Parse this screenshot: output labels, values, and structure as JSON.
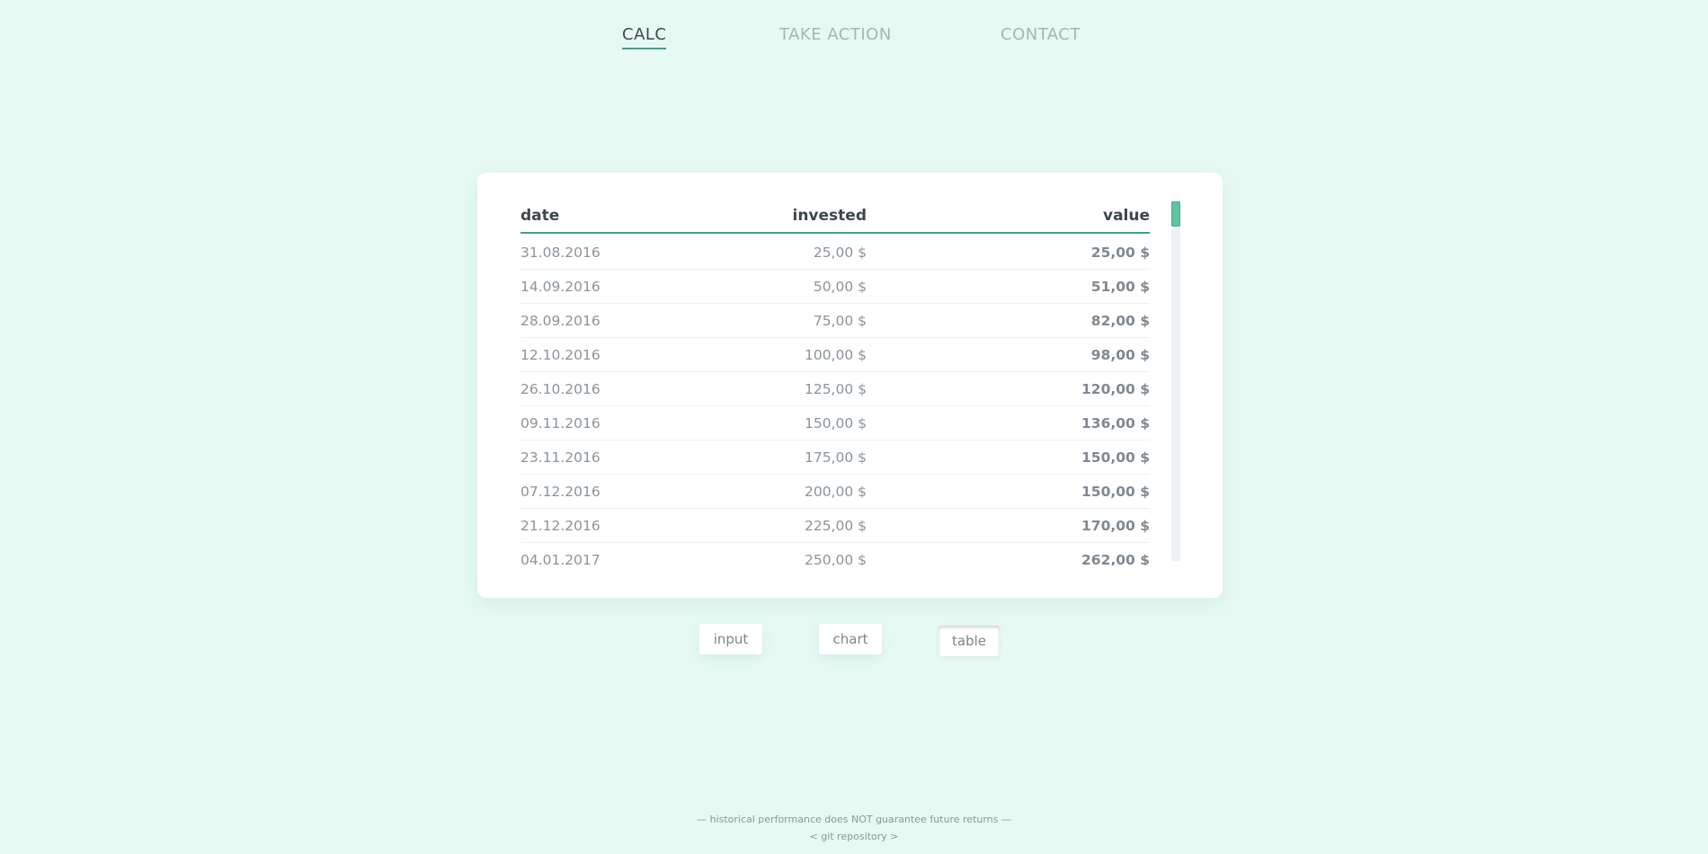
{
  "nav": {
    "calc": "CALC",
    "take_action": "TAKE ACTION",
    "contact": "CONTACT"
  },
  "table": {
    "headers": {
      "date": "date",
      "invested": "invested",
      "value": "value"
    },
    "rows": [
      {
        "date": "31.08.2016",
        "invested": "25,00 $",
        "value": "25,00 $"
      },
      {
        "date": "14.09.2016",
        "invested": "50,00 $",
        "value": "51,00 $"
      },
      {
        "date": "28.09.2016",
        "invested": "75,00 $",
        "value": "82,00 $"
      },
      {
        "date": "12.10.2016",
        "invested": "100,00 $",
        "value": "98,00 $"
      },
      {
        "date": "26.10.2016",
        "invested": "125,00 $",
        "value": "120,00 $"
      },
      {
        "date": "09.11.2016",
        "invested": "150,00 $",
        "value": "136,00 $"
      },
      {
        "date": "23.11.2016",
        "invested": "175,00 $",
        "value": "150,00 $"
      },
      {
        "date": "07.12.2016",
        "invested": "200,00 $",
        "value": "150,00 $"
      },
      {
        "date": "21.12.2016",
        "invested": "225,00 $",
        "value": "170,00 $"
      },
      {
        "date": "04.01.2017",
        "invested": "250,00 $",
        "value": "262,00 $"
      }
    ]
  },
  "views": {
    "input": "input",
    "chart": "chart",
    "table": "table"
  },
  "footer": {
    "disclaimer": "— historical performance does NOT guarantee future returns —",
    "git": "< git repository >"
  },
  "colors": {
    "background": "#e6faf3",
    "accent": "#3aa580",
    "scroll_thumb": "#5fc39f"
  }
}
